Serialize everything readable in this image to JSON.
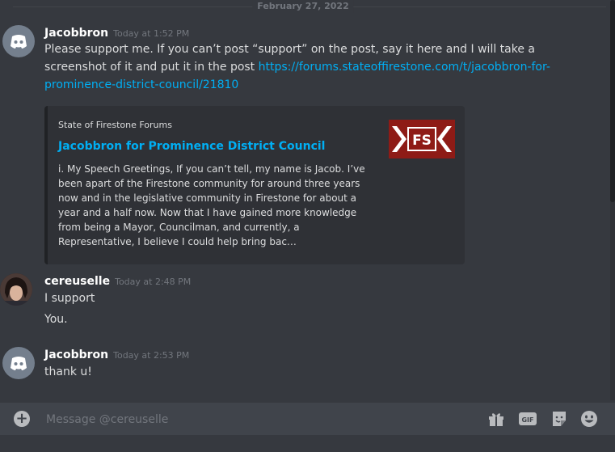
{
  "divider": {
    "date": "February 27, 2022"
  },
  "messages": [
    {
      "username": "Jacobbron",
      "timestamp": "Today at 1:52 PM",
      "text": "Please support me. If you can’t post “support” on the post, say it here and I will take a screenshot of it and put it in the post ",
      "link": "https://forums.stateoffirestone.com/t/jacobbron-for-prominence-district-council/21810",
      "embed": {
        "provider": "State of Firestone Forums",
        "title": "Jacobbron for Prominence District Council",
        "description": "i. My Speech Greetings, If you can’t tell, my name is Jacob. I’ve been apart of the Firestone community for around three years now and in the legislative community in Firestone for about a year and a half now. Now that I have gained more knowledge from being a Mayor, Councilman, and currently, a Representative, I believe I could help bring bac…",
        "thumb_text": "FS"
      }
    },
    {
      "username": "cereuselle",
      "timestamp": "Today at 2:48 PM",
      "lines": [
        "I support",
        "You."
      ]
    },
    {
      "username": "Jacobbron",
      "timestamp": "Today at 2:53 PM",
      "text": "thank u!"
    }
  ],
  "composer": {
    "placeholder": "Message @cereuselle",
    "gif_label": "GIF"
  },
  "colors": {
    "background": "#36393f",
    "link": "#00aff4",
    "embed_bg": "#2f3136",
    "thumb_red": "#8e1b16"
  }
}
